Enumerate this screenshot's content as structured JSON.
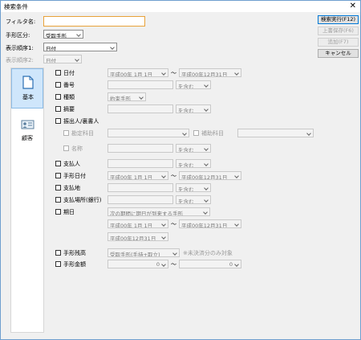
{
  "window": {
    "title": "検索条件",
    "close": "✕"
  },
  "header": {
    "filter_label": "フィルタ名:",
    "filter_value": "",
    "kubun_label": "手形区分:",
    "kubun_value": "受取手形",
    "order1_label": "表示順序1:",
    "order1_value": "日付",
    "order2_label": "表示順序2:",
    "order2_value": "日付"
  },
  "buttons": {
    "search": "検索実行(F12)",
    "overwrite": "上書保存(F6)",
    "add": "追加(F7)",
    "cancel": "キャンセル"
  },
  "sidebar": {
    "items": [
      {
        "label": "基本",
        "selected": true
      },
      {
        "label": "顧客",
        "selected": false
      }
    ]
  },
  "conditions": {
    "date": {
      "label": "日付",
      "from": "平成00年 1月 1日",
      "tilde": "〜",
      "to": "平成00年12月31日"
    },
    "number": {
      "label": "番号",
      "suffix": "を含む"
    },
    "type": {
      "label": "種類",
      "value": "約束手形"
    },
    "summary": {
      "label": "摘要",
      "suffix": "を含む"
    },
    "party": {
      "label": "振出人/裏書人"
    },
    "account": {
      "label": "勘定科目"
    },
    "sub_account": {
      "label": "補助科目"
    },
    "name": {
      "label": "名称",
      "suffix": "を含む"
    },
    "payer": {
      "label": "支払人",
      "suffix": "を含む"
    },
    "note_date": {
      "label": "手形日付",
      "from": "平成00年 1月 1日",
      "tilde": "〜",
      "to": "平成00年12月31日"
    },
    "pay_place": {
      "label": "支払地",
      "suffix": "を含む"
    },
    "pay_location": {
      "label": "支払場所(銀行)",
      "suffix": "を含む"
    },
    "due_date": {
      "label": "期日",
      "mode": "次の期間に期日が到来する手形",
      "from": "平成00年 1月 1日",
      "tilde": "〜",
      "to": "平成00年12月31日",
      "single": "平成00年12月31日"
    },
    "balance": {
      "label": "手形残高",
      "value": "受取手形(手持+取立)",
      "note": "※未決済分のみ対象"
    },
    "amount": {
      "label": "手形金額",
      "from": "0",
      "tilde": "〜",
      "to": "0"
    }
  }
}
